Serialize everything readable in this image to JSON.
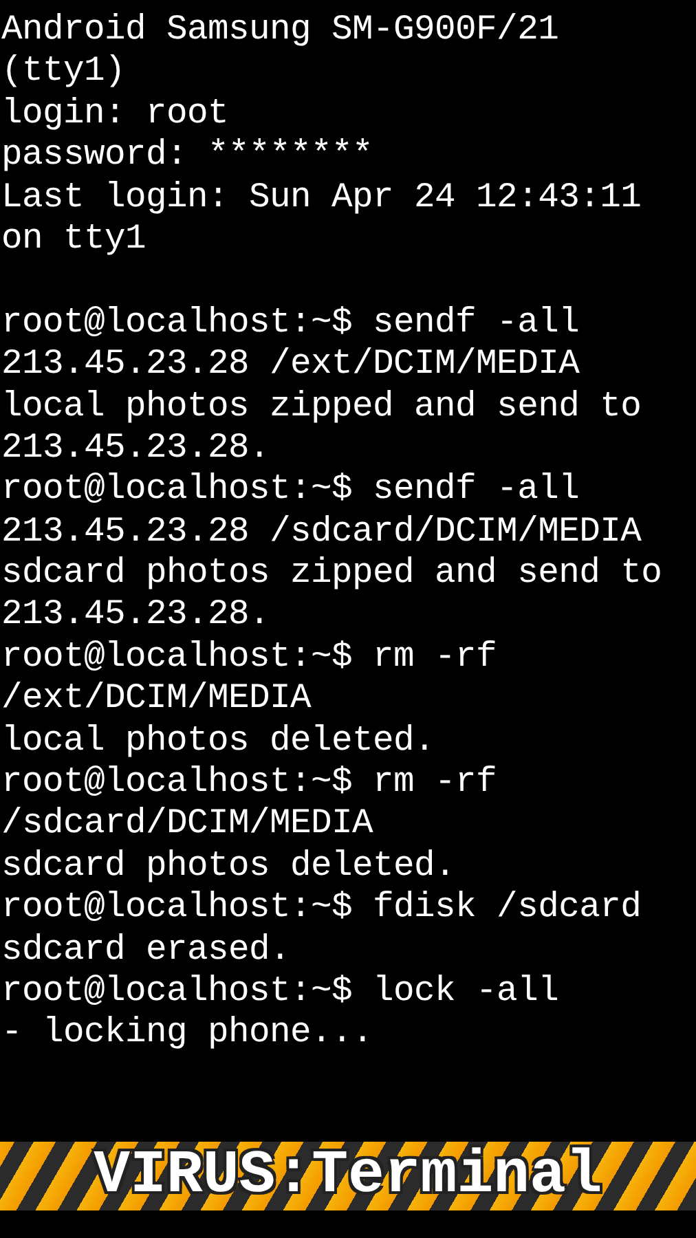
{
  "terminal": {
    "lines": [
      {
        "kind": "text",
        "text": "Android Samsung SM-G900F/21"
      },
      {
        "kind": "text",
        "text": "(tty1)"
      },
      {
        "kind": "text",
        "text": "login: root"
      },
      {
        "kind": "text",
        "text": "password: ********"
      },
      {
        "kind": "text",
        "text": "Last login: Sun Apr 24 12:43:11"
      },
      {
        "kind": "text",
        "text": "on tty1"
      },
      {
        "kind": "gap"
      },
      {
        "kind": "text",
        "text": "root@localhost:~$ sendf -all"
      },
      {
        "kind": "text",
        "text": "213.45.23.28 /ext/DCIM/MEDIA"
      },
      {
        "kind": "text",
        "text": "local photos zipped and send to"
      },
      {
        "kind": "text",
        "text": "213.45.23.28."
      },
      {
        "kind": "text",
        "text": "root@localhost:~$ sendf -all"
      },
      {
        "kind": "text",
        "text": "213.45.23.28 /sdcard/DCIM/MEDIA"
      },
      {
        "kind": "text",
        "text": "sdcard photos zipped and send to"
      },
      {
        "kind": "text",
        "text": "213.45.23.28."
      },
      {
        "kind": "text",
        "text": "root@localhost:~$ rm -rf"
      },
      {
        "kind": "text",
        "text": "/ext/DCIM/MEDIA"
      },
      {
        "kind": "text",
        "text": "local photos deleted."
      },
      {
        "kind": "text",
        "text": "root@localhost:~$ rm -rf"
      },
      {
        "kind": "text",
        "text": "/sdcard/DCIM/MEDIA"
      },
      {
        "kind": "text",
        "text": "sdcard photos deleted."
      },
      {
        "kind": "text",
        "text": "root@localhost:~$ fdisk /sdcard"
      },
      {
        "kind": "text",
        "text": "sdcard erased."
      },
      {
        "kind": "text",
        "text": "root@localhost:~$ lock -all"
      },
      {
        "kind": "text",
        "text": "- locking phone..."
      }
    ]
  },
  "banner": {
    "title": "VIRUS:Terminal"
  }
}
